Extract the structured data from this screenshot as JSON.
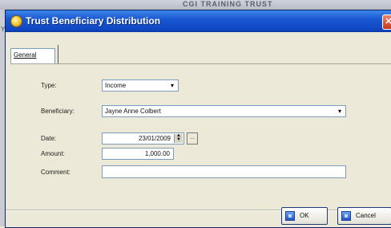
{
  "background": {
    "app_text": "CGI TRAINING TRUST"
  },
  "dialog": {
    "title": "Trust Beneficiary Distribution",
    "close_glyph": "✕",
    "accent_color": "#1a58d3",
    "tabs": [
      {
        "label": "General",
        "selected": true
      }
    ],
    "fields": {
      "type": {
        "label": "Type:",
        "value": "Income",
        "icon": "chevron-down-icon"
      },
      "beneficiary": {
        "label": "Beneficiary:",
        "value": "Jayne Anne Colbert",
        "icon": "chevron-down-icon"
      },
      "date": {
        "label": "Date:",
        "value": "23/01/2009",
        "icon": "spin-icon",
        "picker_label": "..."
      },
      "amount": {
        "label": "Amount:",
        "value": "1,000.00"
      },
      "comment": {
        "label": "Comment:",
        "value": ""
      }
    },
    "buttons": {
      "ok": {
        "label": "OK",
        "icon": "ok-icon"
      },
      "cancel": {
        "label": "Cancel",
        "icon": "cancel-icon"
      }
    }
  }
}
